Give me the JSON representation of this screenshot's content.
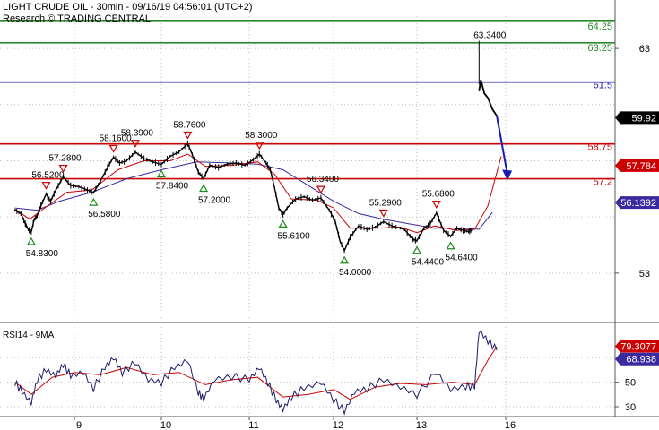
{
  "header": {
    "title": "LIGHT CRUDE OIL - 30min - 09/16/19 04:56:01 (UTC+2)",
    "subtitle": "Research © TRADING CENTRAL"
  },
  "colors": {
    "price": "#000000",
    "ma_fast": "#cc0000",
    "ma_slow": "#3a2aa0",
    "resistance": "#cc0000",
    "target": "#2a8a2a",
    "pivot": "#1a1ab0",
    "arrow": "#1a1ab0",
    "rsi": "#1a1a6a",
    "rsi_ma": "#cc0000",
    "grid": "#bbbbbb",
    "up_marker": "#1a8a1a",
    "down_marker": "#cc0000"
  },
  "chart_data": [
    {
      "type": "line",
      "name": "price-panel",
      "x_labels": [
        "9",
        "10",
        "11",
        "12",
        "13",
        "16"
      ],
      "y_ticks": [
        53,
        63
      ],
      "ylim": [
        51.0,
        64.6
      ],
      "grid": true,
      "price_series": [
        {
          "d": 8.2,
          "v": 55.8
        },
        {
          "d": 8.28,
          "v": 55.65
        },
        {
          "d": 8.34,
          "v": 55.2
        },
        {
          "d": 8.38,
          "v": 54.95
        },
        {
          "d": 8.42,
          "v": 54.83
        },
        {
          "d": 8.46,
          "v": 55.4
        },
        {
          "d": 8.5,
          "v": 55.55
        },
        {
          "d": 8.55,
          "v": 56.0
        },
        {
          "d": 8.62,
          "v": 56.52
        },
        {
          "d": 8.68,
          "v": 56.2
        },
        {
          "d": 8.75,
          "v": 56.7
        },
        {
          "d": 8.85,
          "v": 57.28
        },
        {
          "d": 8.95,
          "v": 56.9
        },
        {
          "d": 9.05,
          "v": 56.85
        },
        {
          "d": 9.15,
          "v": 56.7
        },
        {
          "d": 9.22,
          "v": 56.58
        },
        {
          "d": 9.3,
          "v": 57.1
        },
        {
          "d": 9.38,
          "v": 57.7
        },
        {
          "d": 9.45,
          "v": 58.16
        },
        {
          "d": 9.52,
          "v": 57.9
        },
        {
          "d": 9.6,
          "v": 58.0
        },
        {
          "d": 9.7,
          "v": 58.39
        },
        {
          "d": 9.8,
          "v": 58.1
        },
        {
          "d": 9.9,
          "v": 57.95
        },
        {
          "d": 10.0,
          "v": 57.84
        },
        {
          "d": 10.1,
          "v": 58.2
        },
        {
          "d": 10.2,
          "v": 58.4
        },
        {
          "d": 10.3,
          "v": 58.76
        },
        {
          "d": 10.35,
          "v": 58.3
        },
        {
          "d": 10.42,
          "v": 57.5
        },
        {
          "d": 10.48,
          "v": 57.2
        },
        {
          "d": 10.55,
          "v": 57.8
        },
        {
          "d": 10.65,
          "v": 57.7
        },
        {
          "d": 10.75,
          "v": 57.85
        },
        {
          "d": 10.85,
          "v": 57.9
        },
        {
          "d": 10.95,
          "v": 57.8
        },
        {
          "d": 11.05,
          "v": 58.05
        },
        {
          "d": 11.12,
          "v": 58.3
        },
        {
          "d": 11.2,
          "v": 57.9
        },
        {
          "d": 11.25,
          "v": 57.6
        },
        {
          "d": 11.3,
          "v": 56.8
        },
        {
          "d": 11.35,
          "v": 55.9
        },
        {
          "d": 11.4,
          "v": 55.61
        },
        {
          "d": 11.45,
          "v": 55.9
        },
        {
          "d": 11.55,
          "v": 56.3
        },
        {
          "d": 11.65,
          "v": 56.4
        },
        {
          "d": 11.75,
          "v": 56.25
        },
        {
          "d": 11.85,
          "v": 56.34
        },
        {
          "d": 11.95,
          "v": 55.8
        },
        {
          "d": 12.02,
          "v": 55.3
        },
        {
          "d": 12.08,
          "v": 54.4
        },
        {
          "d": 12.13,
          "v": 54.0
        },
        {
          "d": 12.2,
          "v": 54.6
        },
        {
          "d": 12.3,
          "v": 55.1
        },
        {
          "d": 12.4,
          "v": 54.95
        },
        {
          "d": 12.5,
          "v": 55.05
        },
        {
          "d": 12.6,
          "v": 55.29
        },
        {
          "d": 12.7,
          "v": 55.1
        },
        {
          "d": 12.85,
          "v": 54.95
        },
        {
          "d": 12.95,
          "v": 54.5
        },
        {
          "d": 13.0,
          "v": 54.44
        },
        {
          "d": 13.08,
          "v": 55.0
        },
        {
          "d": 13.15,
          "v": 55.2
        },
        {
          "d": 13.22,
          "v": 55.68
        },
        {
          "d": 13.3,
          "v": 54.9
        },
        {
          "d": 13.38,
          "v": 54.64
        },
        {
          "d": 13.45,
          "v": 55.0
        },
        {
          "d": 13.52,
          "v": 54.9
        },
        {
          "d": 13.58,
          "v": 54.85
        },
        {
          "d": 13.62,
          "v": 54.9
        }
      ],
      "gap_spike": {
        "d": 13.7,
        "high": 63.34,
        "low": 61.4
      },
      "after_gap": [
        {
          "d": 13.7,
          "v": 61.1
        },
        {
          "d": 13.72,
          "v": 61.6
        },
        {
          "d": 13.76,
          "v": 61.0
        },
        {
          "d": 13.8,
          "v": 60.8
        },
        {
          "d": 13.85,
          "v": 60.3
        },
        {
          "d": 13.9,
          "v": 60.0
        }
      ],
      "ma_fast": [
        {
          "d": 8.2,
          "v": 55.85
        },
        {
          "d": 8.4,
          "v": 55.4
        },
        {
          "d": 8.6,
          "v": 55.9
        },
        {
          "d": 8.9,
          "v": 56.6
        },
        {
          "d": 9.2,
          "v": 56.7
        },
        {
          "d": 9.5,
          "v": 57.6
        },
        {
          "d": 9.8,
          "v": 58.0
        },
        {
          "d": 10.1,
          "v": 58.0
        },
        {
          "d": 10.3,
          "v": 58.3
        },
        {
          "d": 10.5,
          "v": 57.75
        },
        {
          "d": 10.8,
          "v": 57.8
        },
        {
          "d": 11.1,
          "v": 57.95
        },
        {
          "d": 11.3,
          "v": 57.4
        },
        {
          "d": 11.5,
          "v": 56.3
        },
        {
          "d": 11.8,
          "v": 56.25
        },
        {
          "d": 12.0,
          "v": 55.9
        },
        {
          "d": 12.2,
          "v": 55.0
        },
        {
          "d": 12.5,
          "v": 55.0
        },
        {
          "d": 12.8,
          "v": 55.05
        },
        {
          "d": 13.0,
          "v": 54.8
        },
        {
          "d": 13.2,
          "v": 55.1
        },
        {
          "d": 13.45,
          "v": 54.9
        },
        {
          "d": 13.65,
          "v": 54.95
        },
        {
          "d": 13.8,
          "v": 56.0
        },
        {
          "d": 13.95,
          "v": 58.2
        }
      ],
      "ma_slow": [
        {
          "d": 8.2,
          "v": 55.9
        },
        {
          "d": 8.5,
          "v": 55.8
        },
        {
          "d": 8.8,
          "v": 56.2
        },
        {
          "d": 9.2,
          "v": 56.6
        },
        {
          "d": 9.6,
          "v": 57.2
        },
        {
          "d": 10.0,
          "v": 57.6
        },
        {
          "d": 10.4,
          "v": 57.95
        },
        {
          "d": 10.8,
          "v": 57.9
        },
        {
          "d": 11.1,
          "v": 57.85
        },
        {
          "d": 11.4,
          "v": 57.6
        },
        {
          "d": 11.7,
          "v": 56.9
        },
        {
          "d": 12.0,
          "v": 56.2
        },
        {
          "d": 12.3,
          "v": 55.65
        },
        {
          "d": 12.6,
          "v": 55.4
        },
        {
          "d": 12.9,
          "v": 55.2
        },
        {
          "d": 13.2,
          "v": 55.0
        },
        {
          "d": 13.5,
          "v": 55.0
        },
        {
          "d": 13.7,
          "v": 54.95
        },
        {
          "d": 13.85,
          "v": 55.7
        }
      ],
      "levels": [
        {
          "value": 64.25,
          "label": "64.25",
          "kind": "target"
        },
        {
          "value": 63.25,
          "label": "63.25",
          "kind": "target"
        },
        {
          "value": 61.5,
          "label": "61.5",
          "kind": "pivot"
        },
        {
          "value": 58.75,
          "label": "58.75",
          "kind": "resistance"
        },
        {
          "value": 57.2,
          "label": "57.2",
          "kind": "resistance"
        }
      ],
      "badges": [
        {
          "value": 59.92,
          "label": "59.92",
          "kind": "last"
        },
        {
          "value": 57.784,
          "label": "57.784",
          "kind": "ma_fast"
        },
        {
          "value": 56.1392,
          "label": "56.1392",
          "kind": "ma_slow"
        }
      ],
      "peaks": [
        {
          "d": 8.62,
          "v": 56.52,
          "label": "56.5200"
        },
        {
          "d": 8.85,
          "v": 57.28,
          "label": "57.2800"
        },
        {
          "d": 9.45,
          "v": 58.16,
          "label": "58.1600"
        },
        {
          "d": 9.7,
          "v": 58.39,
          "label": "58.3900"
        },
        {
          "d": 10.3,
          "v": 58.76,
          "label": "58.7600"
        },
        {
          "d": 11.12,
          "v": 58.3,
          "label": "58.3000"
        },
        {
          "d": 11.85,
          "v": 56.34,
          "label": "56.3400"
        },
        {
          "d": 12.6,
          "v": 55.29,
          "label": "55.2900"
        },
        {
          "d": 13.22,
          "v": 55.68,
          "label": "55.6800"
        }
      ],
      "troughs": [
        {
          "d": 8.42,
          "v": 54.83,
          "label": "54.8300"
        },
        {
          "d": 9.22,
          "v": 56.58,
          "label": "56.5800"
        },
        {
          "d": 10.0,
          "v": 57.84,
          "label": "57.8400"
        },
        {
          "d": 10.48,
          "v": 57.2,
          "label": "57.2000"
        },
        {
          "d": 11.4,
          "v": 55.61,
          "label": "55.6100"
        },
        {
          "d": 12.13,
          "v": 54.0,
          "label": "54.0000"
        },
        {
          "d": 13.0,
          "v": 54.44,
          "label": "54.4400"
        },
        {
          "d": 13.38,
          "v": 54.64,
          "label": "54.6400"
        }
      ],
      "spike_label": "63.3400",
      "projection": {
        "from": {
          "d": 13.9,
          "v": 60.0
        },
        "to": {
          "d": 14.02,
          "v": 57.2
        }
      }
    },
    {
      "type": "line",
      "name": "rsi-panel",
      "title": "RSI14 - 9MA",
      "ylim": [
        22,
        95
      ],
      "y_ticks": [
        30,
        50
      ],
      "grid": true,
      "rsi": [
        {
          "d": 8.2,
          "v": 50
        },
        {
          "d": 8.3,
          "v": 42
        },
        {
          "d": 8.42,
          "v": 33
        },
        {
          "d": 8.5,
          "v": 52
        },
        {
          "d": 8.62,
          "v": 60
        },
        {
          "d": 8.75,
          "v": 55
        },
        {
          "d": 8.85,
          "v": 65
        },
        {
          "d": 8.95,
          "v": 55
        },
        {
          "d": 9.1,
          "v": 58
        },
        {
          "d": 9.22,
          "v": 45
        },
        {
          "d": 9.35,
          "v": 62
        },
        {
          "d": 9.45,
          "v": 70
        },
        {
          "d": 9.55,
          "v": 58
        },
        {
          "d": 9.7,
          "v": 66
        },
        {
          "d": 9.85,
          "v": 52
        },
        {
          "d": 10.0,
          "v": 50
        },
        {
          "d": 10.15,
          "v": 62
        },
        {
          "d": 10.3,
          "v": 68
        },
        {
          "d": 10.42,
          "v": 42
        },
        {
          "d": 10.48,
          "v": 36
        },
        {
          "d": 10.6,
          "v": 52
        },
        {
          "d": 10.8,
          "v": 55
        },
        {
          "d": 11.0,
          "v": 52
        },
        {
          "d": 11.12,
          "v": 62
        },
        {
          "d": 11.22,
          "v": 50
        },
        {
          "d": 11.32,
          "v": 35
        },
        {
          "d": 11.4,
          "v": 28
        },
        {
          "d": 11.5,
          "v": 38
        },
        {
          "d": 11.65,
          "v": 45
        },
        {
          "d": 11.85,
          "v": 50
        },
        {
          "d": 12.0,
          "v": 36
        },
        {
          "d": 12.13,
          "v": 26
        },
        {
          "d": 12.25,
          "v": 42
        },
        {
          "d": 12.4,
          "v": 45
        },
        {
          "d": 12.6,
          "v": 52
        },
        {
          "d": 12.8,
          "v": 46
        },
        {
          "d": 13.0,
          "v": 40
        },
        {
          "d": 13.22,
          "v": 58
        },
        {
          "d": 13.38,
          "v": 44
        },
        {
          "d": 13.55,
          "v": 47
        },
        {
          "d": 13.65,
          "v": 46
        },
        {
          "d": 13.7,
          "v": 92
        },
        {
          "d": 13.8,
          "v": 84
        },
        {
          "d": 13.9,
          "v": 76
        }
      ],
      "rsi_ma": [
        {
          "d": 8.2,
          "v": 50
        },
        {
          "d": 8.42,
          "v": 40
        },
        {
          "d": 8.7,
          "v": 54
        },
        {
          "d": 9.0,
          "v": 58
        },
        {
          "d": 9.3,
          "v": 56
        },
        {
          "d": 9.6,
          "v": 62
        },
        {
          "d": 9.9,
          "v": 56
        },
        {
          "d": 10.2,
          "v": 58
        },
        {
          "d": 10.5,
          "v": 48
        },
        {
          "d": 10.8,
          "v": 52
        },
        {
          "d": 11.1,
          "v": 54
        },
        {
          "d": 11.4,
          "v": 38
        },
        {
          "d": 11.7,
          "v": 40
        },
        {
          "d": 12.0,
          "v": 44
        },
        {
          "d": 12.2,
          "v": 36
        },
        {
          "d": 12.5,
          "v": 46
        },
        {
          "d": 12.8,
          "v": 49
        },
        {
          "d": 13.1,
          "v": 48
        },
        {
          "d": 13.4,
          "v": 50
        },
        {
          "d": 13.65,
          "v": 48
        },
        {
          "d": 13.8,
          "v": 68
        },
        {
          "d": 13.9,
          "v": 79
        }
      ],
      "badges": [
        {
          "value": 79.3077,
          "label": "79.3077",
          "kind": "rsi_ma"
        },
        {
          "value": 68.938,
          "label": "68.938",
          "kind": "rsi"
        }
      ]
    }
  ]
}
